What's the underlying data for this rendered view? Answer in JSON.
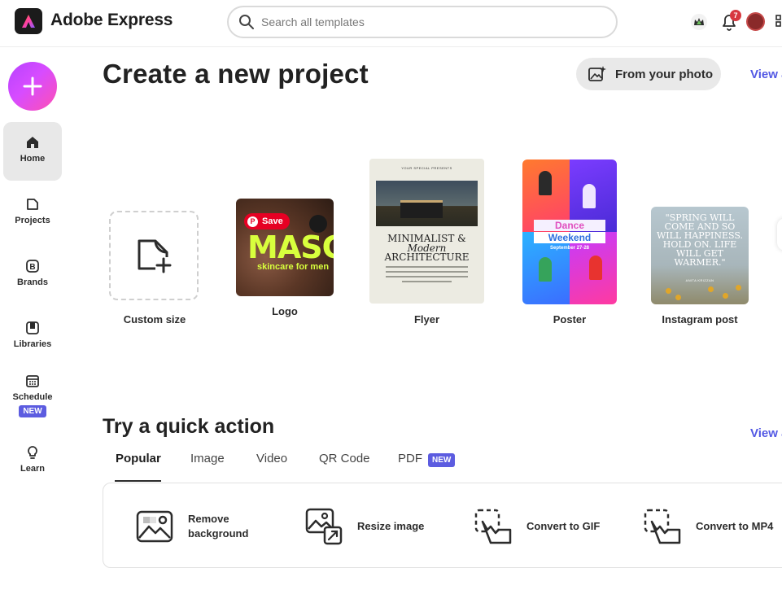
{
  "header": {
    "app_name": "Adobe Express",
    "search_placeholder": "Search all templates",
    "notification_count": "7"
  },
  "sidebar": {
    "items": [
      {
        "label": "Home",
        "icon": "home-icon",
        "active": true
      },
      {
        "label": "Projects",
        "icon": "projects-icon"
      },
      {
        "label": "Brands",
        "icon": "brands-icon"
      },
      {
        "label": "Libraries",
        "icon": "libraries-icon"
      },
      {
        "label": "Schedule",
        "icon": "calendar-icon",
        "badge": "NEW"
      },
      {
        "label": "Learn",
        "icon": "lightbulb-icon"
      }
    ]
  },
  "create": {
    "title": "Create a new project",
    "from_photo_label": "From your photo",
    "view_all_label": "View all",
    "cards": [
      {
        "label": "Custom size"
      },
      {
        "label": "Logo",
        "pinterest_save": "Save",
        "thumb_title": "MASC",
        "thumb_subtitle": "skincare for men"
      },
      {
        "label": "Flyer",
        "thumb_top": "YOUR SPECIAL PRESENTS",
        "thumb_line1": "MINIMALIST &",
        "thumb_line2": "Modern",
        "thumb_line3": "ARCHITECTURE"
      },
      {
        "label": "Poster",
        "thumb_line1": "Dance",
        "thumb_line2": "Weekend",
        "thumb_date": "September 27-28"
      },
      {
        "label": "Instagram post",
        "thumb_quote": "\"SPRING WILL COME AND SO WILL HAPPINESS. HOLD ON. LIFE WILL GET WARMER.\"",
        "thumb_author": "ANITA KRIZZAN"
      }
    ]
  },
  "quick_actions": {
    "title": "Try a quick action",
    "view_all_label": "View all",
    "tabs": [
      {
        "label": "Popular",
        "active": true
      },
      {
        "label": "Image"
      },
      {
        "label": "Video"
      },
      {
        "label": "QR Code"
      },
      {
        "label": "PDF",
        "badge": "NEW"
      }
    ],
    "actions": [
      {
        "label_line1": "Remove",
        "label_line2": "background",
        "icon": "remove-background-icon"
      },
      {
        "label_line1": "Resize image",
        "icon": "resize-image-icon"
      },
      {
        "label_line1": "Convert to GIF",
        "icon": "convert-gif-icon"
      },
      {
        "label_line1": "Convert to MP4",
        "icon": "convert-mp4-icon"
      }
    ]
  },
  "colors": {
    "accent": "#5258e4",
    "badge": "#5c5ce0",
    "fab_gradient_start": "#b642ff",
    "fab_gradient_end": "#ff4fb2"
  }
}
